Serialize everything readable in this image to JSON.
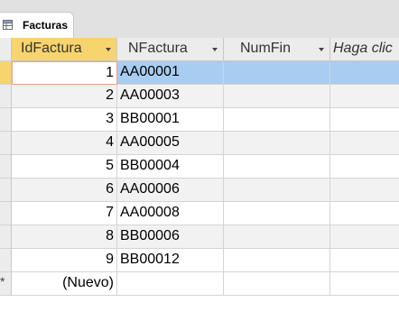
{
  "tab": {
    "title": "Facturas",
    "icon": "table-icon"
  },
  "columns": [
    {
      "label": "IdFactura",
      "sortable": true,
      "active": true
    },
    {
      "label": "NFactura",
      "sortable": true,
      "active": false
    },
    {
      "label": "NumFin",
      "sortable": true,
      "active": false
    },
    {
      "label": "Haga clic",
      "sortable": false,
      "active": false
    }
  ],
  "rows": [
    {
      "id": "1",
      "nfactura": "AA00001",
      "numfin": ""
    },
    {
      "id": "2",
      "nfactura": "AA00003",
      "numfin": ""
    },
    {
      "id": "3",
      "nfactura": "BB00001",
      "numfin": ""
    },
    {
      "id": "4",
      "nfactura": "AA00005",
      "numfin": ""
    },
    {
      "id": "5",
      "nfactura": "BB00004",
      "numfin": ""
    },
    {
      "id": "6",
      "nfactura": "AA00006",
      "numfin": ""
    },
    {
      "id": "7",
      "nfactura": "AA00008",
      "numfin": ""
    },
    {
      "id": "8",
      "nfactura": "BB00006",
      "numfin": ""
    },
    {
      "id": "9",
      "nfactura": "BB00012",
      "numfin": ""
    }
  ],
  "new_row": {
    "marker": "*",
    "label": "(Nuevo)"
  },
  "colors": {
    "active_header": "#f8d46e",
    "selection": "#a9cdf0",
    "alt_row": "#f2f2f2"
  }
}
